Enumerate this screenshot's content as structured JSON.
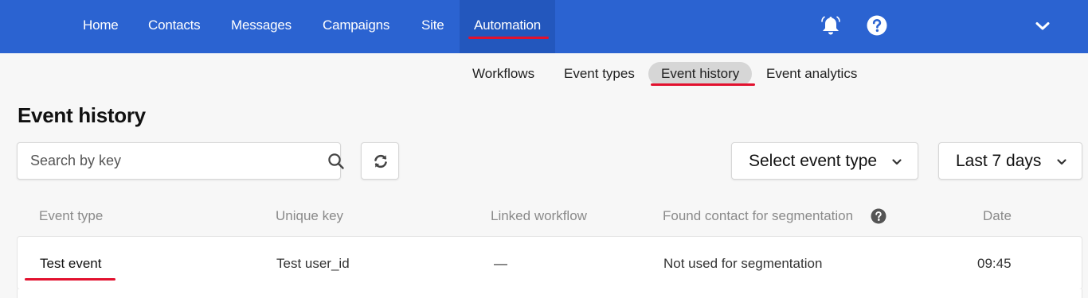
{
  "topnav": {
    "items": [
      {
        "label": "Home"
      },
      {
        "label": "Contacts"
      },
      {
        "label": "Messages"
      },
      {
        "label": "Campaigns"
      },
      {
        "label": "Site"
      },
      {
        "label": "Automation",
        "active": true
      }
    ],
    "icons": [
      "bell-icon",
      "help-circle-icon",
      "chevron-down-icon"
    ]
  },
  "subnav": {
    "items": [
      {
        "label": "Workflows"
      },
      {
        "label": "Event types"
      },
      {
        "label": "Event history",
        "active": true
      },
      {
        "label": "Event analytics"
      }
    ]
  },
  "page": {
    "title": "Event history"
  },
  "search": {
    "placeholder": "Search by key",
    "value": ""
  },
  "filters": {
    "event_type": {
      "label": "Select event type"
    },
    "period": {
      "label": "Last 7 days"
    }
  },
  "table": {
    "columns": [
      "Event type",
      "Unique key",
      "Linked workflow",
      "Found contact for segmentation",
      "Date"
    ],
    "rows": [
      {
        "event_type": "Test event",
        "unique_key": "Test user_id",
        "linked_workflow": "—",
        "found_contact": "Not used for segmentation",
        "date": "09:45"
      }
    ]
  },
  "colors": {
    "nav_bg": "#2b63d1",
    "nav_active_bg": "#2357bd",
    "highlight_underline": "#e2112e",
    "page_bg": "#f7f7f7"
  }
}
